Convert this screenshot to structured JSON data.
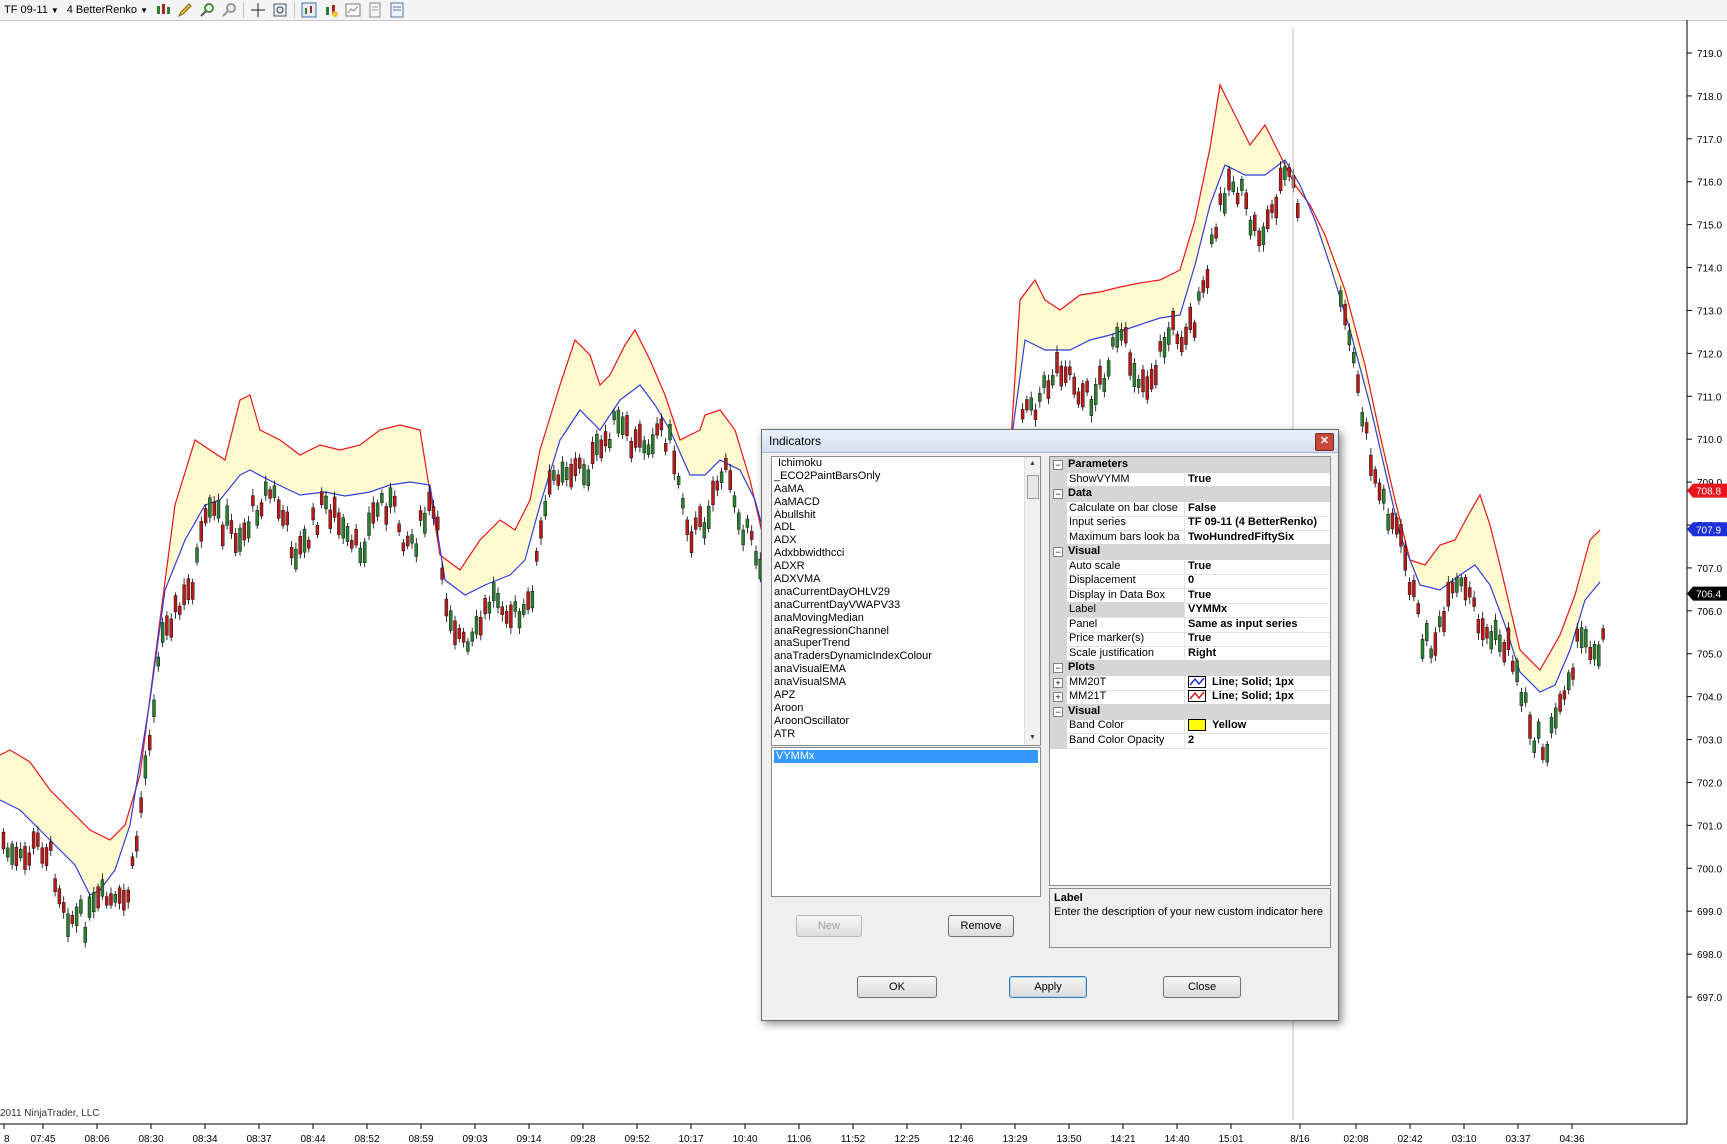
{
  "toolbar": {
    "instrument": "TF 09-11",
    "bar_type": "4 BetterRenko",
    "icons": [
      "candlestick-icon",
      "pencil-draw-icon",
      "zoom-in-icon",
      "zoom-out-icon",
      "crosshair-icon",
      "magnifier-icon",
      "indicators-icon",
      "strategies-icon",
      "chart-style-icon",
      "data-box-icon",
      "properties-icon"
    ]
  },
  "chart": {
    "copyright": "2011 NinjaTrader, LLC",
    "price_axis": [
      "719.0",
      "718.0",
      "717.0",
      "716.0",
      "715.0",
      "714.0",
      "713.0",
      "712.0",
      "711.0",
      "710.0",
      "709.0",
      "708.0",
      "707.0",
      "706.0",
      "705.0",
      "704.0",
      "703.0",
      "702.0",
      "701.0",
      "700.0",
      "699.0",
      "698.0",
      "697.0"
    ],
    "price_markers": [
      {
        "label": "708.8",
        "color": "#e8141c"
      },
      {
        "label": "707.9",
        "color": "#1d2fd6"
      },
      {
        "label": "706.4",
        "color": "#000000"
      }
    ],
    "time_axis": [
      "8",
      "07:45",
      "08:06",
      "08:30",
      "08:34",
      "08:37",
      "08:44",
      "08:52",
      "08:59",
      "09:03",
      "09:14",
      "09:28",
      "09:52",
      "10:17",
      "10:40",
      "11:06",
      "11:52",
      "12:25",
      "12:46",
      "13:29",
      "13:50",
      "14:21",
      "14:40",
      "15:01",
      "8/16",
      "02:08",
      "02:42",
      "03:10",
      "03:37",
      "04:36"
    ],
    "colors": {
      "upper_band": "#e8141c",
      "lower_band": "#2f3fd8",
      "band_fill": "#fffbd1",
      "up_bar": "#2e7d32",
      "down_bar": "#b71c1c"
    }
  },
  "dialog": {
    "title": "Indicators",
    "indicator_list": [
      "Ichimoku",
      "_ECO2PaintBarsOnly",
      "AaMA",
      "AaMACD",
      "Abullshit",
      "ADL",
      "ADX",
      "Adxbbwidthcci",
      "ADXR",
      "ADXVMA",
      "anaCurrentDayOHLV29",
      "anaCurrentDayVWAPV33",
      "anaMovingMedian",
      "anaRegressionChannel",
      "anaSuperTrend",
      "anaTradersDynamicIndexColour",
      "anaVisualEMA",
      "anaVisualSMA",
      "APZ",
      "Aroon",
      "AroonOscillator",
      "ATR"
    ],
    "applied": [
      "VYMMx"
    ],
    "buttons": {
      "new": "New",
      "remove": "Remove",
      "ok": "OK",
      "apply": "Apply",
      "close": "Close"
    },
    "properties": [
      {
        "type": "category",
        "label": "Parameters"
      },
      {
        "type": "prop",
        "name": "ShowVYMM",
        "value": "True"
      },
      {
        "type": "category",
        "label": "Data"
      },
      {
        "type": "prop",
        "name": "Calculate on bar close",
        "value": "False"
      },
      {
        "type": "prop",
        "name": "Input series",
        "value": "TF 09-11 (4 BetterRenko)"
      },
      {
        "type": "prop",
        "name": "Maximum bars look ba",
        "value": "TwoHundredFiftySix"
      },
      {
        "type": "category",
        "label": "Visual"
      },
      {
        "type": "prop",
        "name": "Auto scale",
        "value": "True"
      },
      {
        "type": "prop",
        "name": "Displacement",
        "value": "0"
      },
      {
        "type": "prop",
        "name": "Display in Data Box",
        "value": "True"
      },
      {
        "type": "prop",
        "name": "Label",
        "value": "VYMMx",
        "selected": true
      },
      {
        "type": "prop",
        "name": "Panel",
        "value": "Same as input series"
      },
      {
        "type": "prop",
        "name": "Price marker(s)",
        "value": "True"
      },
      {
        "type": "prop",
        "name": "Scale justification",
        "value": "Right"
      },
      {
        "type": "category",
        "label": "Plots"
      },
      {
        "type": "plot",
        "name": "MM20T",
        "value": "Line; Solid; 1px",
        "color": "#1d2fd6"
      },
      {
        "type": "plot",
        "name": "MM21T",
        "value": "Line; Solid; 1px",
        "color": "#e8141c"
      },
      {
        "type": "category",
        "label": "Visual"
      },
      {
        "type": "color",
        "name": "Band Color",
        "value": "Yellow",
        "color": "#ffff00"
      },
      {
        "type": "prop",
        "name": "Band Color Opacity",
        "value": "2"
      }
    ],
    "description": {
      "title": "Label",
      "text": "Enter the description of your new custom indicator here"
    }
  }
}
